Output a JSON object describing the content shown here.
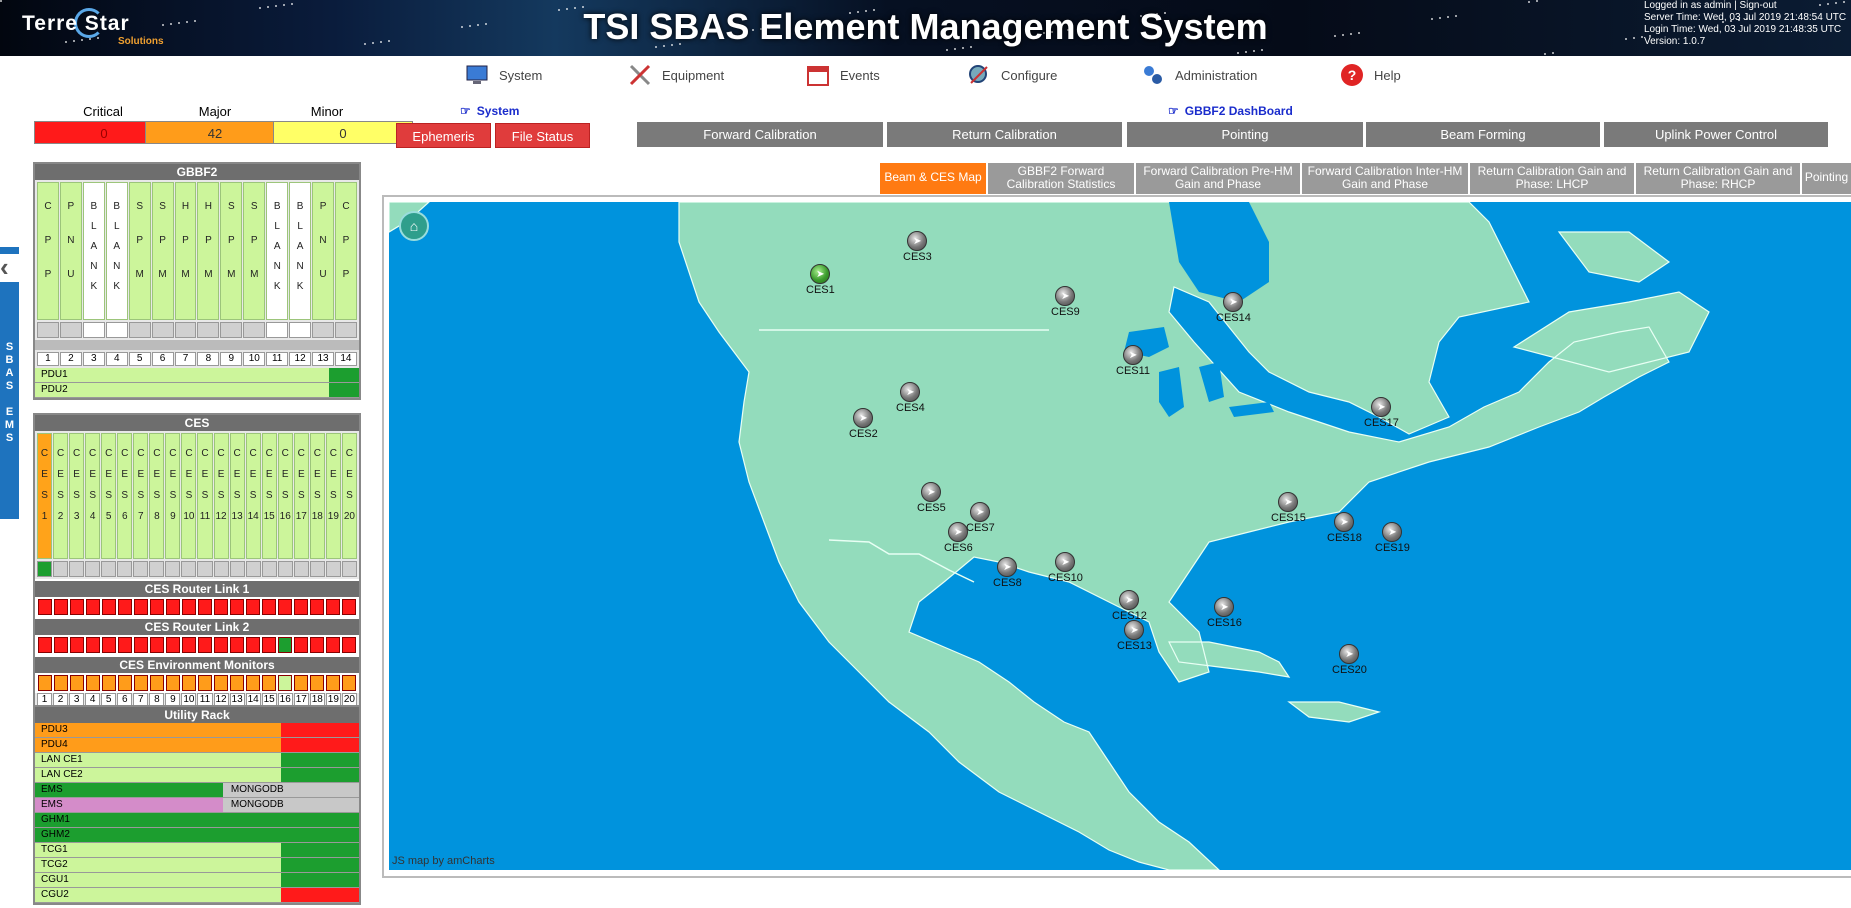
{
  "banner": {
    "logo_text": "Terre Star",
    "logo_sub": "Solutions",
    "title": "TSI SBAS Element Management System",
    "login_line": "Logged in as admin | Sign-out",
    "server_time": "Server Time: Wed, 03 Jul 2019 21:48:54 UTC",
    "login_time": "Login Time:  Wed, 03 Jul 2019 21:48:35 UTC",
    "version": "Version: 1.0.7"
  },
  "nav": [
    {
      "label": "System",
      "icon": "monitor-icon"
    },
    {
      "label": "Equipment",
      "icon": "tools-icon"
    },
    {
      "label": "Events",
      "icon": "calendar-icon"
    },
    {
      "label": "Configure",
      "icon": "configure-icon"
    },
    {
      "label": "Administration",
      "icon": "admin-gears-icon"
    },
    {
      "label": "Help",
      "icon": "help-icon"
    }
  ],
  "alarms": {
    "critical": {
      "label": "Critical",
      "count": "0",
      "color": "#ff1a1a"
    },
    "major": {
      "label": "Major",
      "count": "42",
      "color": "#ff9c1a"
    },
    "minor": {
      "label": "Minor",
      "count": "0",
      "color": "#ffff66"
    }
  },
  "sidetab": {
    "text": "SBAS EMS"
  },
  "gbbf2": {
    "title": "GBBF2",
    "slots": [
      {
        "letters": [
          "C",
          "P",
          "P"
        ],
        "type": "green",
        "ind": "gray"
      },
      {
        "letters": [
          "P",
          "N",
          "U"
        ],
        "type": "green",
        "ind": "gray"
      },
      {
        "letters": [
          "B",
          "L",
          "A",
          "N",
          "K"
        ],
        "type": "blank",
        "ind": "white"
      },
      {
        "letters": [
          "B",
          "L",
          "A",
          "N",
          "K"
        ],
        "type": "blank",
        "ind": "white"
      },
      {
        "letters": [
          "S",
          "P",
          "M"
        ],
        "type": "green",
        "ind": "gray"
      },
      {
        "letters": [
          "S",
          "P",
          "M"
        ],
        "type": "green",
        "ind": "gray"
      },
      {
        "letters": [
          "H",
          "P",
          "M"
        ],
        "type": "green",
        "ind": "gray"
      },
      {
        "letters": [
          "H",
          "P",
          "M"
        ],
        "type": "green",
        "ind": "gray"
      },
      {
        "letters": [
          "S",
          "P",
          "M"
        ],
        "type": "green",
        "ind": "gray"
      },
      {
        "letters": [
          "S",
          "P",
          "M"
        ],
        "type": "green",
        "ind": "gray"
      },
      {
        "letters": [
          "B",
          "L",
          "A",
          "N",
          "K"
        ],
        "type": "blank",
        "ind": "white"
      },
      {
        "letters": [
          "B",
          "L",
          "A",
          "N",
          "K"
        ],
        "type": "blank",
        "ind": "white"
      },
      {
        "letters": [
          "P",
          "N",
          "U"
        ],
        "type": "green",
        "ind": "gray"
      },
      {
        "letters": [
          "C",
          "P",
          "P"
        ],
        "type": "green",
        "ind": "gray"
      }
    ],
    "numbers": [
      "1",
      "2",
      "3",
      "4",
      "5",
      "6",
      "7",
      "8",
      "9",
      "10",
      "11",
      "12",
      "13",
      "14"
    ],
    "pdus": [
      "PDU1",
      "PDU2"
    ]
  },
  "ces_panel": {
    "title": "CES",
    "slot_letters": [
      "C",
      "E",
      "S"
    ],
    "numbers": [
      "1",
      "2",
      "3",
      "4",
      "5",
      "6",
      "7",
      "8",
      "9",
      "10",
      "11",
      "12",
      "13",
      "14",
      "15",
      "16",
      "17",
      "18",
      "19",
      "20"
    ],
    "router1_title": "CES Router Link 1",
    "router1": [
      "r",
      "r",
      "r",
      "r",
      "r",
      "r",
      "r",
      "r",
      "r",
      "r",
      "r",
      "r",
      "r",
      "r",
      "r",
      "r",
      "r",
      "r",
      "r",
      "r"
    ],
    "router2_title": "CES Router Link 2",
    "router2": [
      "r",
      "r",
      "r",
      "r",
      "r",
      "r",
      "r",
      "r",
      "r",
      "r",
      "r",
      "r",
      "r",
      "r",
      "r",
      "g",
      "r",
      "r",
      "r",
      "r"
    ],
    "env_title": "CES Environment Monitors",
    "env": [
      "o",
      "o",
      "o",
      "o",
      "o",
      "o",
      "o",
      "o",
      "o",
      "o",
      "o",
      "o",
      "o",
      "o",
      "o",
      "l",
      "o",
      "o",
      "o",
      "o"
    ]
  },
  "utility": {
    "title": "Utility Rack",
    "rows": [
      {
        "label": "PDU3",
        "left": "#ff9c1a",
        "right": "#ff1a1a",
        "split": 0.76,
        "note": ""
      },
      {
        "label": "PDU4",
        "left": "#ff9c1a",
        "right": "#ff1a1a",
        "split": 0.76,
        "note": ""
      },
      {
        "label": "LAN CE1",
        "left": "#ccf59b",
        "right": "#1c9e2f",
        "split": 0.76,
        "note": ""
      },
      {
        "label": "LAN CE2",
        "left": "#ccf59b",
        "right": "#1c9e2f",
        "split": 0.76,
        "note": ""
      },
      {
        "label": "EMS",
        "left": "#1c9e2f",
        "right": "#c8c8c8",
        "split": 0.58,
        "note": "MONGODB"
      },
      {
        "label": "EMS",
        "left": "#d48cc9",
        "right": "#c8c8c8",
        "split": 0.58,
        "note": "MONGODB"
      },
      {
        "label": "GHM1",
        "left": "#1c9e2f",
        "right": "#1c9e2f",
        "split": 0.76,
        "note": ""
      },
      {
        "label": "GHM2",
        "left": "#1c9e2f",
        "right": "#1c9e2f",
        "split": 0.76,
        "note": ""
      },
      {
        "label": "TCG1",
        "left": "#ccf59b",
        "right": "#1c9e2f",
        "split": 0.76,
        "note": ""
      },
      {
        "label": "TCG2",
        "left": "#ccf59b",
        "right": "#1c9e2f",
        "split": 0.76,
        "note": ""
      },
      {
        "label": "CGU1",
        "left": "#ccf59b",
        "right": "#1c9e2f",
        "split": 0.76,
        "note": ""
      },
      {
        "label": "CGU2",
        "left": "#ccf59b",
        "right": "#ff1a1a",
        "split": 0.76,
        "note": ""
      }
    ]
  },
  "system_link": "System",
  "dashboard_link": "GBBF2 DashBoard",
  "red_buttons": [
    "Ephemeris",
    "File Status"
  ],
  "gray_buttons": [
    "Forward Calibration",
    "Return Calibration",
    "Pointing",
    "Beam Forming",
    "Uplink Power Control"
  ],
  "tabs": [
    "Beam & CES Map",
    "GBBF2 Forward Calibration Statistics",
    "Forward Calibration Pre-HM Gain and Phase",
    "Forward Calibration Inter-HM Gain and Phase",
    "Return Calibration Gain and Phase: LHCP",
    "Return Calibration Gain and Phase: RHCP",
    "Pointing"
  ],
  "map": {
    "credit": "JS map by amCharts",
    "ocean_color": "#0093dd",
    "land_color": "#93dcbc",
    "markers": [
      {
        "name": "CES1",
        "status": "green"
      },
      {
        "name": "CES3",
        "status": "gray"
      },
      {
        "name": "CES9",
        "status": "gray"
      },
      {
        "name": "CES14",
        "status": "gray"
      },
      {
        "name": "CES11",
        "status": "gray"
      },
      {
        "name": "CES4",
        "status": "gray"
      },
      {
        "name": "CES2",
        "status": "gray"
      },
      {
        "name": "CES17",
        "status": "gray"
      },
      {
        "name": "CES5",
        "status": "gray"
      },
      {
        "name": "CES7",
        "status": "gray"
      },
      {
        "name": "CES6",
        "status": "gray"
      },
      {
        "name": "CES15",
        "status": "gray"
      },
      {
        "name": "CES18",
        "status": "gray"
      },
      {
        "name": "CES19",
        "status": "gray"
      },
      {
        "name": "CES8",
        "status": "gray"
      },
      {
        "name": "CES10",
        "status": "gray"
      },
      {
        "name": "CES12",
        "status": "gray"
      },
      {
        "name": "CES16",
        "status": "gray"
      },
      {
        "name": "CES13",
        "status": "gray"
      },
      {
        "name": "CES20",
        "status": "gray"
      }
    ]
  }
}
